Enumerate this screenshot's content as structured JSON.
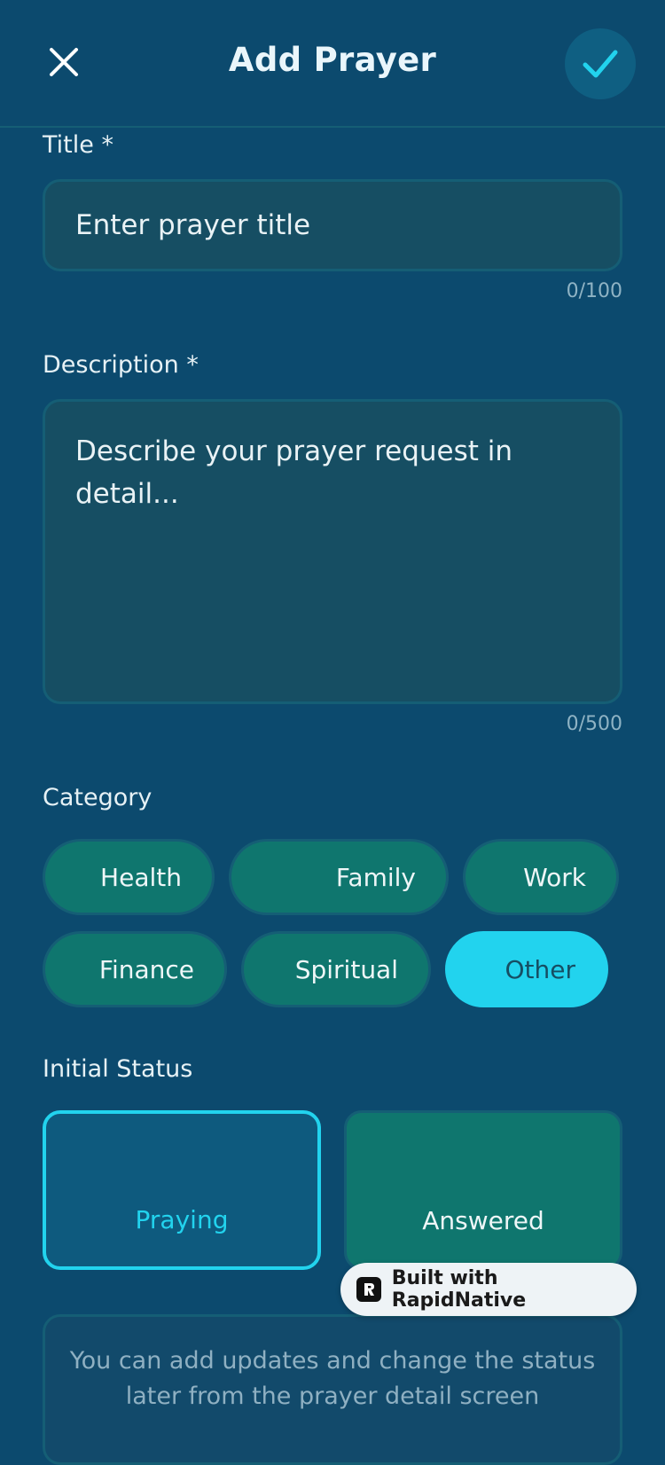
{
  "header": {
    "title": "Add Prayer",
    "close_icon": "close-icon",
    "confirm_icon": "check-icon"
  },
  "form": {
    "title_label": "Title *",
    "title_placeholder": "Enter prayer title",
    "title_counter": "0/100",
    "description_label": "Description *",
    "description_placeholder": "Describe your prayer request in detail...",
    "description_counter": "0/500",
    "category_label": "Category",
    "categories": [
      {
        "label": "Health",
        "selected": false
      },
      {
        "label": "Family",
        "selected": false
      },
      {
        "label": "Work",
        "selected": false
      },
      {
        "label": "Finance",
        "selected": false
      },
      {
        "label": "Spiritual",
        "selected": false
      },
      {
        "label": "Other",
        "selected": true
      }
    ],
    "status_label": "Initial Status",
    "statuses": [
      {
        "label": "Praying",
        "selected": true
      },
      {
        "label": "Answered",
        "selected": false
      }
    ],
    "info_text": "You can add updates and change the status later from the prayer detail screen"
  },
  "badge": {
    "text": "Built with RapidNative"
  },
  "colors": {
    "background": "#0c4a6e",
    "accent": "#22d3ee",
    "chip": "#0f766e",
    "input": "#164e63"
  }
}
